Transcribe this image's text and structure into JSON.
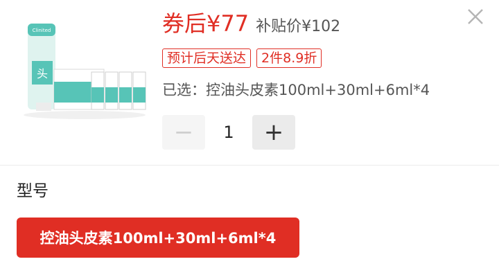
{
  "price": {
    "coupon_price": "券后¥77",
    "subsidy_price": "补贴价¥102"
  },
  "tags": [
    "预计后天送达",
    "2件8.9折"
  ],
  "selected_text": "已选：控油头皮素100ml+30ml+6ml*4",
  "quantity": {
    "minus": "−",
    "value": "1",
    "plus": "+"
  },
  "section": {
    "title": "型号"
  },
  "options": [
    "控油头皮素100ml+30ml+6ml*4"
  ],
  "product": {
    "brand_text": "Clinited",
    "icon": "product-package-image"
  },
  "colors": {
    "accent": "#e02e24",
    "product_teal": "#57c4b7"
  },
  "icons": {
    "close": "close-icon"
  }
}
